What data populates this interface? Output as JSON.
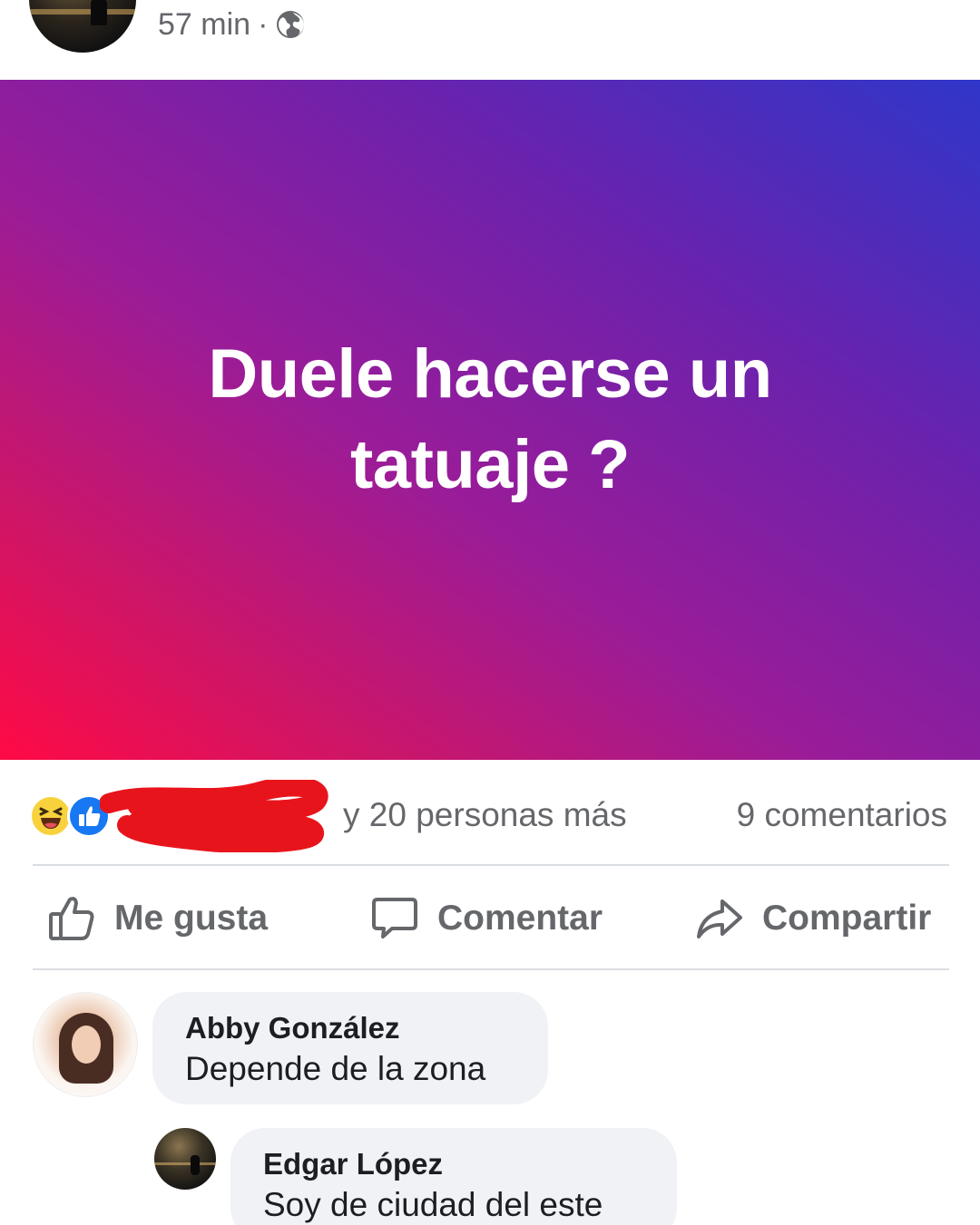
{
  "post": {
    "time": "57 min",
    "separator": "·",
    "audience_icon": "globe-icon",
    "text": "Duele hacerse un tatuaje ?",
    "background_gradient": [
      "#2f36c9",
      "#6b22ad",
      "#9a1c98",
      "#d01565",
      "#ff0a45"
    ]
  },
  "reactions": {
    "icons": [
      "haha-icon",
      "like-icon"
    ],
    "summary": "y 20 personas más",
    "comments_count": "9 comentarios"
  },
  "actions": {
    "like": "Me gusta",
    "comment": "Comentar",
    "share": "Compartir"
  },
  "comments": [
    {
      "author": "Abby González",
      "text": "Depende de la zona"
    },
    {
      "author": "Edgar López",
      "text": "Soy de ciudad del este"
    }
  ],
  "colors": {
    "muted_text": "#65676b",
    "bubble": "#f0f2f5",
    "like_blue": "#1877f2",
    "haha_yellow": "#f7d23c",
    "redaction_red": "#e8141c"
  }
}
